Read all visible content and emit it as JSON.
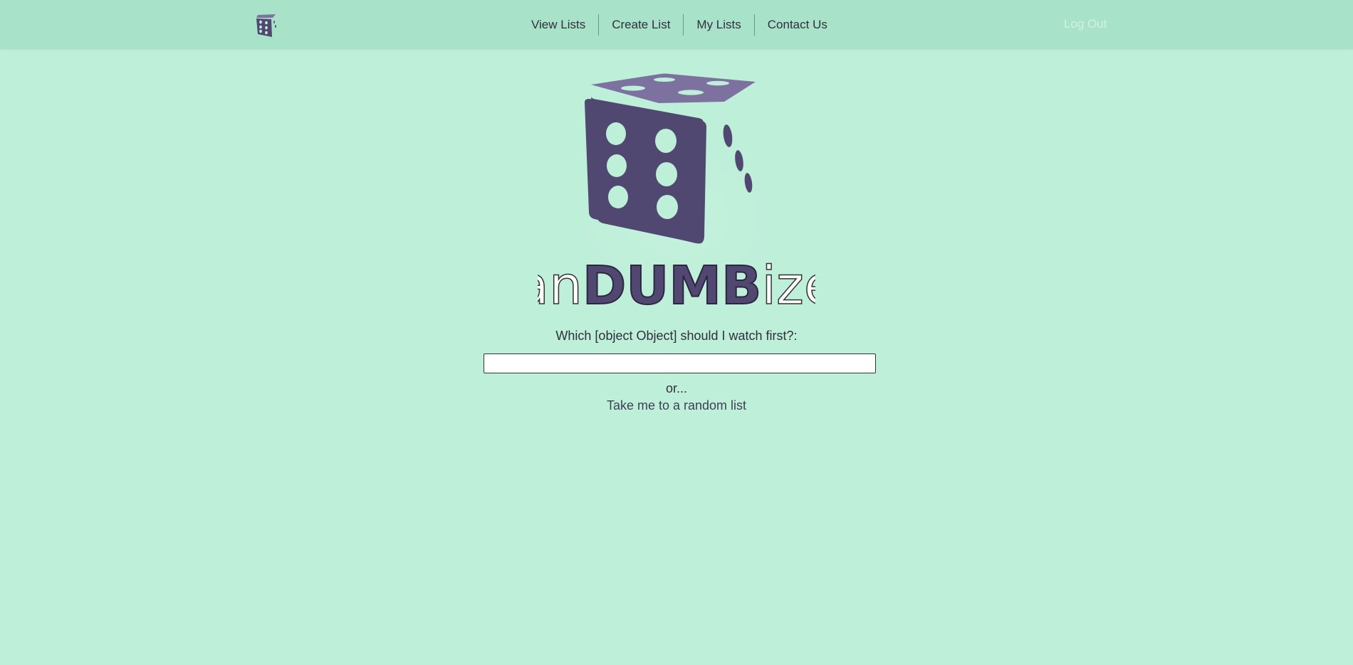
{
  "nav": {
    "logo_icon": "dice-logo-icon",
    "links": [
      {
        "label": "View Lists"
      },
      {
        "label": "Create List"
      },
      {
        "label": "My Lists"
      },
      {
        "label": "Contact Us"
      }
    ],
    "logout_label": "Log Out"
  },
  "hero": {
    "logo_icon": "dice-logo-icon",
    "logo_text_prefix": "ran",
    "logo_text_bold": "DUMB",
    "logo_text_suffix": "izer"
  },
  "main": {
    "prompt": "Which [object Object] should I watch first?:",
    "input_value": "",
    "input_placeholder": "",
    "or_text": "or...",
    "random_link": "Take me to a random list"
  },
  "colors": {
    "background": "#beefd9",
    "navbar": "#a8e3c9",
    "dice_dark": "#514872",
    "dice_top": "#7d71a0",
    "logout": "#d2f2e3"
  }
}
